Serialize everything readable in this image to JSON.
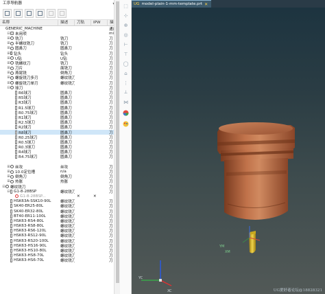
{
  "navigator": {
    "title": "工序导航器",
    "pin_icon": "pin-icon",
    "columns": [
      "名称",
      "描述",
      "刀轨",
      "IPW",
      "描述"
    ],
    "rows": [
      {
        "name": "GENERIC_MACHINE",
        "desc": "",
        "tool": "",
        "ipw": "",
        "last": "通用",
        "level": 0,
        "expand": "",
        "icon": "none"
      },
      {
        "name": "未用项",
        "desc": "",
        "tool": "",
        "ipw": "",
        "last": "mil",
        "level": 1,
        "expand": "⊟",
        "icon": "mach"
      },
      {
        "name": "铣刀",
        "desc": "铣刀",
        "tool": "",
        "ipw": "",
        "last": "刀",
        "level": 1,
        "expand": "⊞",
        "icon": "circle"
      },
      {
        "name": "半螺纹铣刀",
        "desc": "铣刀",
        "tool": "",
        "ipw": "",
        "last": "刀",
        "level": 1,
        "expand": "⊞",
        "icon": "circle"
      },
      {
        "name": "圆鼻刀",
        "desc": "圆鼻刀",
        "tool": "",
        "ipw": "",
        "last": "刀",
        "level": 1,
        "expand": "⊞",
        "icon": "circle"
      },
      {
        "name": "钻头",
        "desc": "钻头",
        "tool": "",
        "ipw": "",
        "last": "刀",
        "level": 1,
        "expand": "⊞",
        "icon": "drill"
      },
      {
        "name": "U钻",
        "desc": "U钻",
        "tool": "",
        "ipw": "",
        "last": "刀",
        "level": 1,
        "expand": "⊞",
        "icon": "circle"
      },
      {
        "name": "铣螺纹刀",
        "desc": "铣刀",
        "tool": "",
        "ipw": "",
        "last": "刀",
        "level": 1,
        "expand": "⊞",
        "icon": "circle"
      },
      {
        "name": "刀片",
        "desc": "面铣刀",
        "tool": "",
        "ipw": "",
        "last": "刀",
        "level": 1,
        "expand": "⊞",
        "icon": "circle"
      },
      {
        "name": "燕尾铣",
        "desc": "倒角刀",
        "tool": "",
        "ipw": "",
        "last": "刀",
        "level": 1,
        "expand": "⊞",
        "icon": "circle"
      },
      {
        "name": "螺旋铣刀多刃",
        "desc": "螺纹铣刀",
        "tool": "",
        "ipw": "",
        "last": "刀",
        "level": 1,
        "expand": "⊞",
        "icon": "circle"
      },
      {
        "name": "螺旋铣刀单刃",
        "desc": "螺纹铣刀",
        "tool": "",
        "ipw": "",
        "last": "刀",
        "level": 1,
        "expand": "⊞",
        "icon": "circle"
      },
      {
        "name": "球刀",
        "desc": "",
        "tool": "",
        "ipw": "",
        "last": "刀",
        "level": 1,
        "expand": "⊟",
        "icon": "circle"
      },
      {
        "name": "R6球刀",
        "desc": "圆鼻刀",
        "tool": "",
        "ipw": "",
        "last": "刀",
        "level": 2,
        "expand": "",
        "icon": "tool"
      },
      {
        "name": "R5球刀",
        "desc": "圆鼻刀",
        "tool": "",
        "ipw": "",
        "last": "刀",
        "level": 2,
        "expand": "",
        "icon": "tool"
      },
      {
        "name": "R3球刀",
        "desc": "圆鼻刀",
        "tool": "",
        "ipw": "",
        "last": "刀",
        "level": 2,
        "expand": "",
        "icon": "tool"
      },
      {
        "name": "R1.5球刀",
        "desc": "圆鼻刀",
        "tool": "",
        "ipw": "",
        "last": "刀",
        "level": 2,
        "expand": "",
        "icon": "tool"
      },
      {
        "name": "R0.75球刀",
        "desc": "圆鼻刀",
        "tool": "",
        "ipw": "",
        "last": "刀",
        "level": 2,
        "expand": "",
        "icon": "tool"
      },
      {
        "name": "R1球刀",
        "desc": "圆鼻刀",
        "tool": "",
        "ipw": "",
        "last": "刀",
        "level": 2,
        "expand": "",
        "icon": "tool"
      },
      {
        "name": "R2.5球刀",
        "desc": "圆鼻刀",
        "tool": "",
        "ipw": "",
        "last": "刀",
        "level": 2,
        "expand": "",
        "icon": "tool"
      },
      {
        "name": "R2球刀",
        "desc": "圆鼻刀",
        "tool": "",
        "ipw": "",
        "last": "刀",
        "level": 2,
        "expand": "",
        "icon": "tool"
      },
      {
        "name": "R8球刀",
        "desc": "圆鼻刀",
        "tool": "",
        "ipw": "",
        "last": "刀",
        "level": 2,
        "expand": "",
        "icon": "tool",
        "selected": true
      },
      {
        "name": "R0.25球刀",
        "desc": "圆鼻刀",
        "tool": "",
        "ipw": "",
        "last": "刀",
        "level": 2,
        "expand": "",
        "icon": "tool"
      },
      {
        "name": "R0.5球刀",
        "desc": "圆鼻刀",
        "tool": "",
        "ipw": "",
        "last": "刀",
        "level": 2,
        "expand": "",
        "icon": "tool"
      },
      {
        "name": "R0.3球刀",
        "desc": "圆鼻刀",
        "tool": "",
        "ipw": "",
        "last": "刀",
        "level": 2,
        "expand": "",
        "icon": "tool"
      },
      {
        "name": "R4球刀",
        "desc": "圆鼻刀",
        "tool": "",
        "ipw": "",
        "last": "刀",
        "level": 2,
        "expand": "",
        "icon": "tool"
      },
      {
        "name": "R4.75球刀",
        "desc": "圆鼻刀",
        "tool": "",
        "ipw": "",
        "last": "刀",
        "level": 2,
        "expand": "",
        "icon": "tool"
      },
      {
        "name": "",
        "desc": "",
        "tool": "",
        "ipw": "",
        "last": "",
        "level": 1,
        "expand": "",
        "icon": "none"
      },
      {
        "name": "丝攻",
        "desc": "丝攻",
        "tool": "",
        "ipw": "",
        "last": "刀",
        "level": 1,
        "expand": "⊞",
        "icon": "circle"
      },
      {
        "name": "10.0定位槽",
        "desc": "n/a",
        "tool": "",
        "ipw": "",
        "last": "刀",
        "level": 1,
        "expand": "⊞",
        "icon": "circle"
      },
      {
        "name": "倒角刀",
        "desc": "倒角刀",
        "tool": "",
        "ipw": "",
        "last": "刀",
        "level": 1,
        "expand": "⊞",
        "icon": "circle"
      },
      {
        "name": "热胀",
        "desc": "热胀",
        "tool": "",
        "ipw": "",
        "last": "刀",
        "level": 1,
        "expand": "⊞",
        "icon": "circle"
      },
      {
        "name": "螺纹铣刀",
        "desc": "",
        "tool": "",
        "ipw": "",
        "last": "刀",
        "level": 0,
        "expand": "⊟",
        "icon": "circle"
      },
      {
        "name": "G1-8-28BSP",
        "desc": "螺纹铣刀",
        "tool": "",
        "ipw": "",
        "last": "刀",
        "level": 1,
        "expand": "⊟",
        "icon": "tool"
      },
      {
        "name": "G1-8-28BSP...",
        "desc": "",
        "tool": "✕",
        "ipw": "✕",
        "last": "",
        "level": 2,
        "expand": "",
        "icon": "err"
      },
      {
        "name": "HSK63A-SSK10-90L",
        "desc": "螺纹铣刀",
        "tool": "",
        "ipw": "",
        "last": "刀",
        "level": 1,
        "expand": "",
        "icon": "tool"
      },
      {
        "name": "SK40-ER25-80L",
        "desc": "螺纹铣刀",
        "tool": "",
        "ipw": "",
        "last": "刀",
        "level": 1,
        "expand": "",
        "icon": "tool"
      },
      {
        "name": "SK40-ER32-80L",
        "desc": "螺纹铣刀",
        "tool": "",
        "ipw": "",
        "last": "刀",
        "level": 1,
        "expand": "",
        "icon": "tool"
      },
      {
        "name": "BT40-ER11-100L",
        "desc": "螺纹铣刀",
        "tool": "",
        "ipw": "",
        "last": "刀",
        "level": 1,
        "expand": "",
        "icon": "tool"
      },
      {
        "name": "HSK63-RS4-80L",
        "desc": "螺纹铣刀",
        "tool": "",
        "ipw": "",
        "last": "刀",
        "level": 1,
        "expand": "",
        "icon": "tool"
      },
      {
        "name": "HSK63-RS8-80L",
        "desc": "螺纹铣刀",
        "tool": "",
        "ipw": "",
        "last": "刀",
        "level": 1,
        "expand": "",
        "icon": "tool"
      },
      {
        "name": "HSK63-RS6-120L",
        "desc": "螺纹铣刀",
        "tool": "",
        "ipw": "",
        "last": "刀",
        "level": 1,
        "expand": "",
        "icon": "tool"
      },
      {
        "name": "HSK63-RS12-90L",
        "desc": "螺纹铣刀",
        "tool": "",
        "ipw": "",
        "last": "刀",
        "level": 1,
        "expand": "",
        "icon": "tool"
      },
      {
        "name": "HSK63-RS20-100L",
        "desc": "螺纹铣刀",
        "tool": "",
        "ipw": "",
        "last": "刀",
        "level": 1,
        "expand": "",
        "icon": "tool"
      },
      {
        "name": "HSK63-HS16-90L",
        "desc": "螺纹铣刀",
        "tool": "",
        "ipw": "",
        "last": "刀",
        "level": 1,
        "expand": "",
        "icon": "tool"
      },
      {
        "name": "HSK63-HS10-80L",
        "desc": "螺纹铣刀",
        "tool": "",
        "ipw": "",
        "last": "刀",
        "level": 1,
        "expand": "",
        "icon": "tool"
      },
      {
        "name": "HSK63-HS8-70L",
        "desc": "螺纹铣刀",
        "tool": "",
        "ipw": "",
        "last": "刀",
        "level": 1,
        "expand": "",
        "icon": "tool"
      },
      {
        "name": "HSK63-HS6-70L",
        "desc": "螺纹铣刀",
        "tool": "",
        "ipw": "",
        "last": "刀",
        "level": 1,
        "expand": "",
        "icon": "tool"
      }
    ]
  },
  "tab": {
    "label": "model-plain-1-mm-template.prt",
    "prefix": "UG",
    "close": "✕"
  },
  "viewport": {
    "axis_labels": {
      "ym": "YM",
      "xm": "XM",
      "zm": "ZM",
      "yc": "YC",
      "xc": "XC"
    },
    "part_color": "#b8673e",
    "tool_color": "#d9b62a"
  },
  "watermark": "UG爱好者论坛@18828321"
}
